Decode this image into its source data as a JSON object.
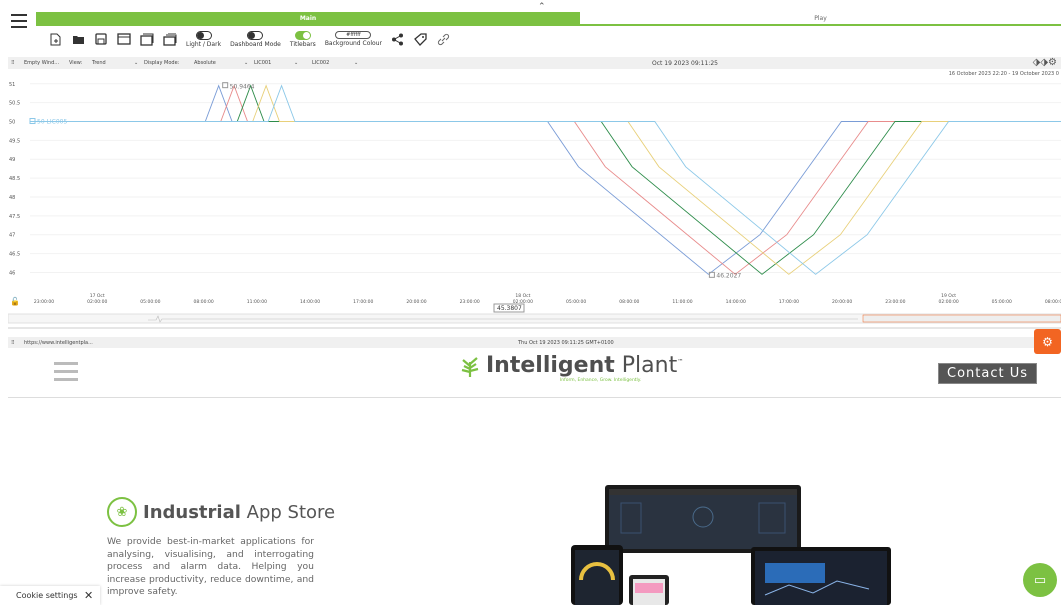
{
  "tabs": {
    "main": "Main",
    "play": "Play"
  },
  "toolbar": {
    "light_dark": "Light / Dark",
    "dashboard_mode": "Dashboard Mode",
    "titlebars": "Titlebars",
    "background_colour": "Background Colour",
    "background_colour_value": "#ffffff"
  },
  "trend_window": {
    "title": "Empty Wind...",
    "view_label": "View:",
    "view_value": "Trend",
    "display_mode_label": "Display Mode:",
    "display_mode_value": "Absolute",
    "tag1": "LIC001",
    "tag2": "LIC002",
    "timestamp": "Oct 19 2023 09:11:25",
    "date_range": "16 October 2023 22:20 - 19 October 2023 0"
  },
  "chart_data": {
    "type": "line",
    "y_ticks": [
      "51",
      "50.5",
      "50",
      "49.5",
      "49",
      "48.5",
      "48",
      "47.5",
      "47",
      "46.5",
      "46"
    ],
    "ylim": [
      45.8,
      51.1
    ],
    "x_ticks": [
      {
        "label": "23:00:00"
      },
      {
        "label": "02:00:00",
        "date": "17 Oct"
      },
      {
        "label": "05:00:00"
      },
      {
        "label": "08:00:00"
      },
      {
        "label": "11:00:00"
      },
      {
        "label": "14:00:00"
      },
      {
        "label": "17:00:00"
      },
      {
        "label": "20:00:00"
      },
      {
        "label": "23:00:00"
      },
      {
        "label": "02:00:00",
        "date": "18 Oct"
      },
      {
        "label": "05:00:00"
      },
      {
        "label": "08:00:00"
      },
      {
        "label": "11:00:00"
      },
      {
        "label": "14:00:00"
      },
      {
        "label": "17:00:00"
      },
      {
        "label": "20:00:00"
      },
      {
        "label": "23:00:00"
      },
      {
        "label": "02:00:00",
        "date": "19 Oct"
      },
      {
        "label": "05:00:00"
      },
      {
        "label": "08:00:00"
      }
    ],
    "annotations": {
      "max_label": "50.9464",
      "start_label": "50 LIC005",
      "min_label": "46.2027",
      "cursor_label": "45.3807"
    },
    "series_colors": [
      "#7a9cd6",
      "#e88c8c",
      "#2d8c4a",
      "#e8d07a",
      "#8cc8e8"
    ],
    "series": [
      {
        "color": "#7a9cd6",
        "peak_x": 0.183,
        "dip_x": [
          0.502,
          0.658,
          0.787
        ]
      },
      {
        "color": "#e88c8c",
        "peak_x": 0.198,
        "dip_x": [
          0.528,
          0.684,
          0.813
        ]
      },
      {
        "color": "#2d8c4a",
        "peak_x": 0.214,
        "dip_x": [
          0.554,
          0.71,
          0.839
        ]
      },
      {
        "color": "#e8d07a",
        "peak_x": 0.229,
        "dip_x": [
          0.58,
          0.736,
          0.865
        ]
      },
      {
        "color": "#8cc8e8",
        "peak_x": 0.244,
        "dip_x": [
          0.606,
          0.762,
          0.891
        ]
      }
    ]
  },
  "web_window": {
    "url": "https://www.intelligentpla...",
    "timestamp": "Thu Oct 19 2023 09:11:25 GMT+0100"
  },
  "site": {
    "logo_bold": "Intelligent",
    "logo_light": "Plant",
    "logo_tm": "™",
    "tagline": "Inform, Enhance, Grow. Intelligently.",
    "contact": "Contact Us",
    "store_bold": "Industrial",
    "store_light": " App Store",
    "store_desc": "We provide best-in-market applications for analysing, visualising, and interrogating process and alarm data. Helping you increase productivity, reduce downtime, and improve safety."
  },
  "cookie": {
    "label": "Cookie settings",
    "close": "✕"
  },
  "colors": {
    "accent": "#7cc142",
    "orange": "#f26522"
  }
}
